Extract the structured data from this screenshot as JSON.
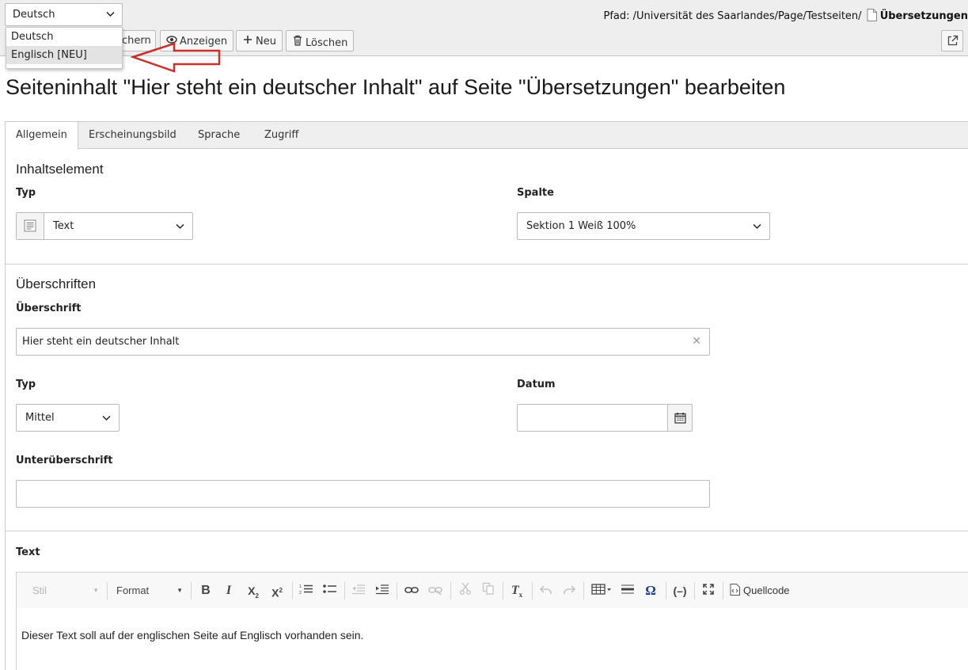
{
  "colors": {
    "arrow": "#c9302c",
    "toolbar_bg": "#eeeeee",
    "tabs_bg": "#efefef"
  },
  "toolbar": {
    "language_value": "Deutsch",
    "language_options": [
      "Deutsch",
      "Englisch [NEU]"
    ],
    "save_label_partial": "chern",
    "view_label": "Anzeigen",
    "new_label": "Neu",
    "delete_label": "Löschen",
    "path_prefix": "Pfad: /Universität des Saarlandes/Page/Testseiten/",
    "path_current": "Übersetzungen"
  },
  "page": {
    "title": "Seiteninhalt \"Hier steht ein deutscher Inhalt\" auf Seite \"Übersetzungen\" bearbeiten"
  },
  "tabs": [
    "Allgemein",
    "Erscheinungsbild",
    "Sprache",
    "Zugriff"
  ],
  "content_element": {
    "section_title": "Inhaltselement",
    "type_label": "Typ",
    "type_value": "Text",
    "column_label": "Spalte",
    "column_value": "Sektion 1 Weiß 100%"
  },
  "headings": {
    "section_title": "Überschriften",
    "header_label": "Überschrift",
    "header_value": "Hier steht ein deutscher Inhalt",
    "type_label": "Typ",
    "type_value": "Mittel",
    "date_label": "Datum",
    "date_value": "",
    "subheader_label": "Unterüberschrift",
    "subheader_value": ""
  },
  "text": {
    "label": "Text",
    "style_combo": "Stil",
    "format_combo": "Format",
    "source_label": "Quellcode",
    "body": "Dieser Text soll auf der englischen Seite auf Englisch vorhanden sein."
  },
  "icons": [
    "chevron-down-icon",
    "eye-icon",
    "plus-icon",
    "trash-icon",
    "external-link-icon",
    "page-icon",
    "text-type-icon",
    "calendar-icon",
    "close-icon",
    "bold-icon",
    "italic-icon",
    "subscript-icon",
    "superscript-icon",
    "numbered-list-icon",
    "bullet-list-icon",
    "outdent-icon",
    "indent-icon",
    "link-icon",
    "unlink-icon",
    "cut-icon",
    "copy-icon",
    "remove-format-icon",
    "undo-icon",
    "redo-icon",
    "table-icon",
    "horizontal-line-icon",
    "special-char-icon",
    "soft-hyphen-icon",
    "maximize-icon",
    "source-icon"
  ]
}
